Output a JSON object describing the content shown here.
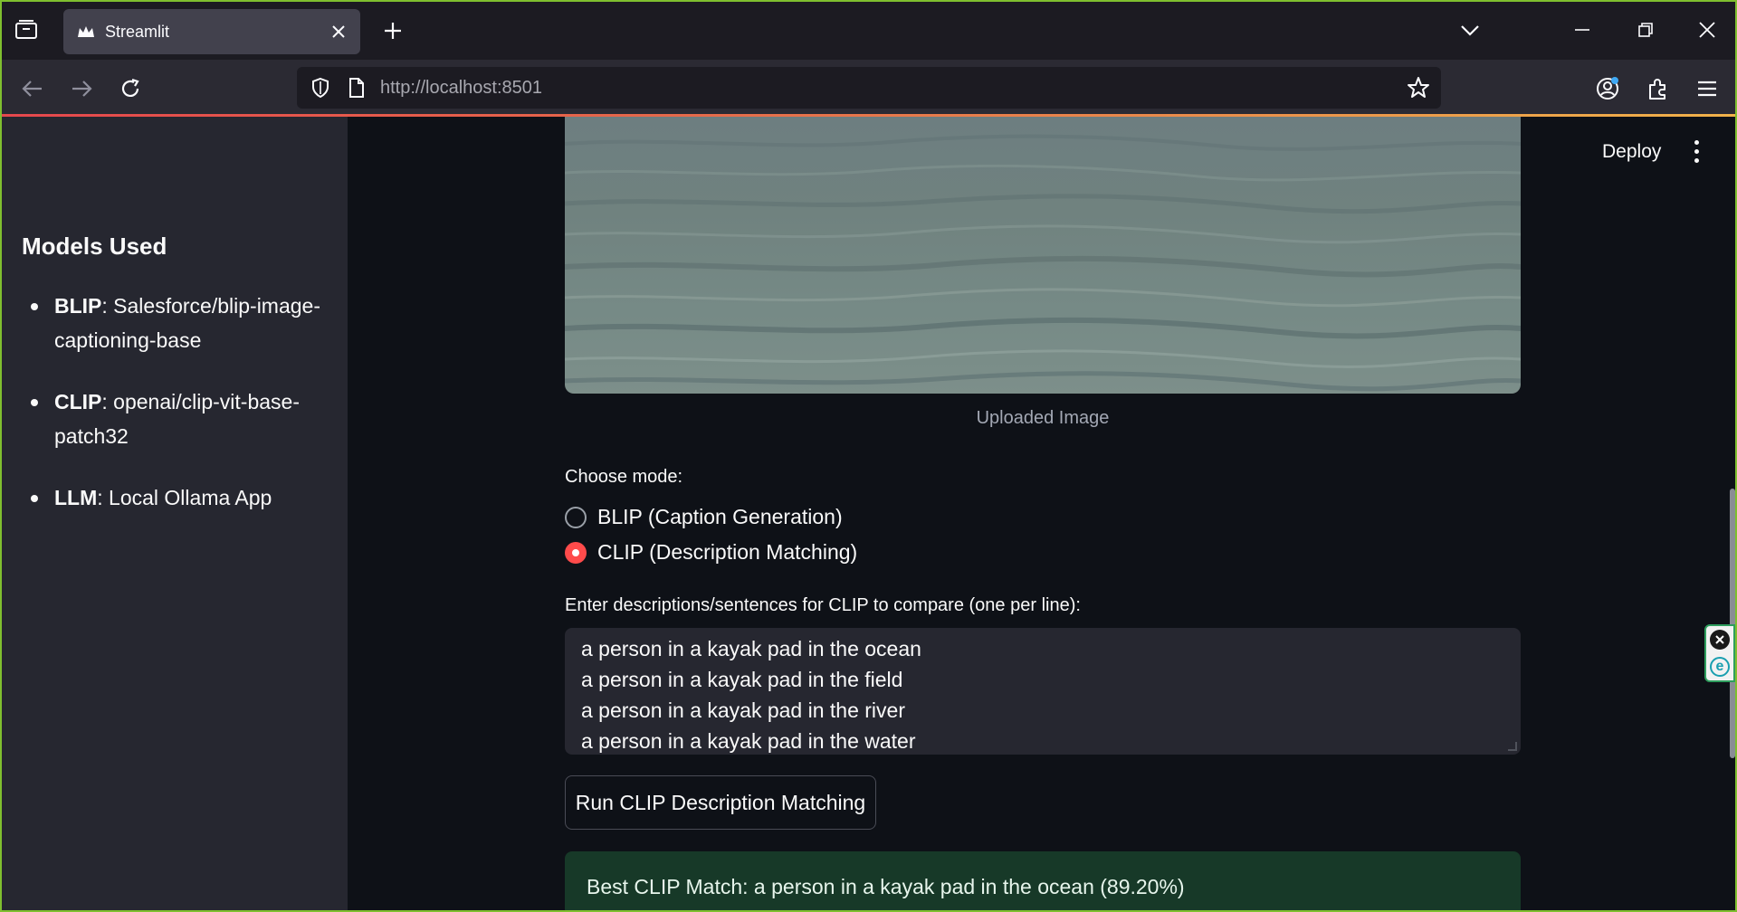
{
  "browser": {
    "tab": {
      "title": "Streamlit"
    },
    "url": {
      "host": "http://localhost",
      "port": ":8501"
    }
  },
  "sidebar": {
    "heading": "Models Used",
    "models": [
      {
        "name": "BLIP",
        "value": ": Salesforce/blip-image-captioning-base"
      },
      {
        "name": "CLIP",
        "value": ": openai/clip-vit-base-patch32"
      },
      {
        "name": "LLM",
        "value": ": Local Ollama App"
      }
    ]
  },
  "header": {
    "deploy_label": "Deploy"
  },
  "main": {
    "image_caption": "Uploaded Image",
    "mode_label": "Choose mode:",
    "modes": [
      {
        "label": "BLIP (Caption Generation)",
        "selected": false
      },
      {
        "label": "CLIP (Description Matching)",
        "selected": true
      }
    ],
    "descriptions_label": "Enter descriptions/sentences for CLIP to compare (one per line):",
    "descriptions": [
      "a person in a kayak pad in the ocean",
      "a person in a kayak pad in the field",
      "a person in a kayak pad in the river",
      "a person in a kayak pad in the water"
    ],
    "run_button_label": "Run CLIP Description Matching",
    "result_text": "Best CLIP Match: a person in a kayak pad in the ocean (89.20%)"
  },
  "colors": {
    "accent": "#ff4b4b",
    "sidebar_bg": "#262730",
    "app_bg": "#0e1117",
    "success_bg": "#173928"
  }
}
